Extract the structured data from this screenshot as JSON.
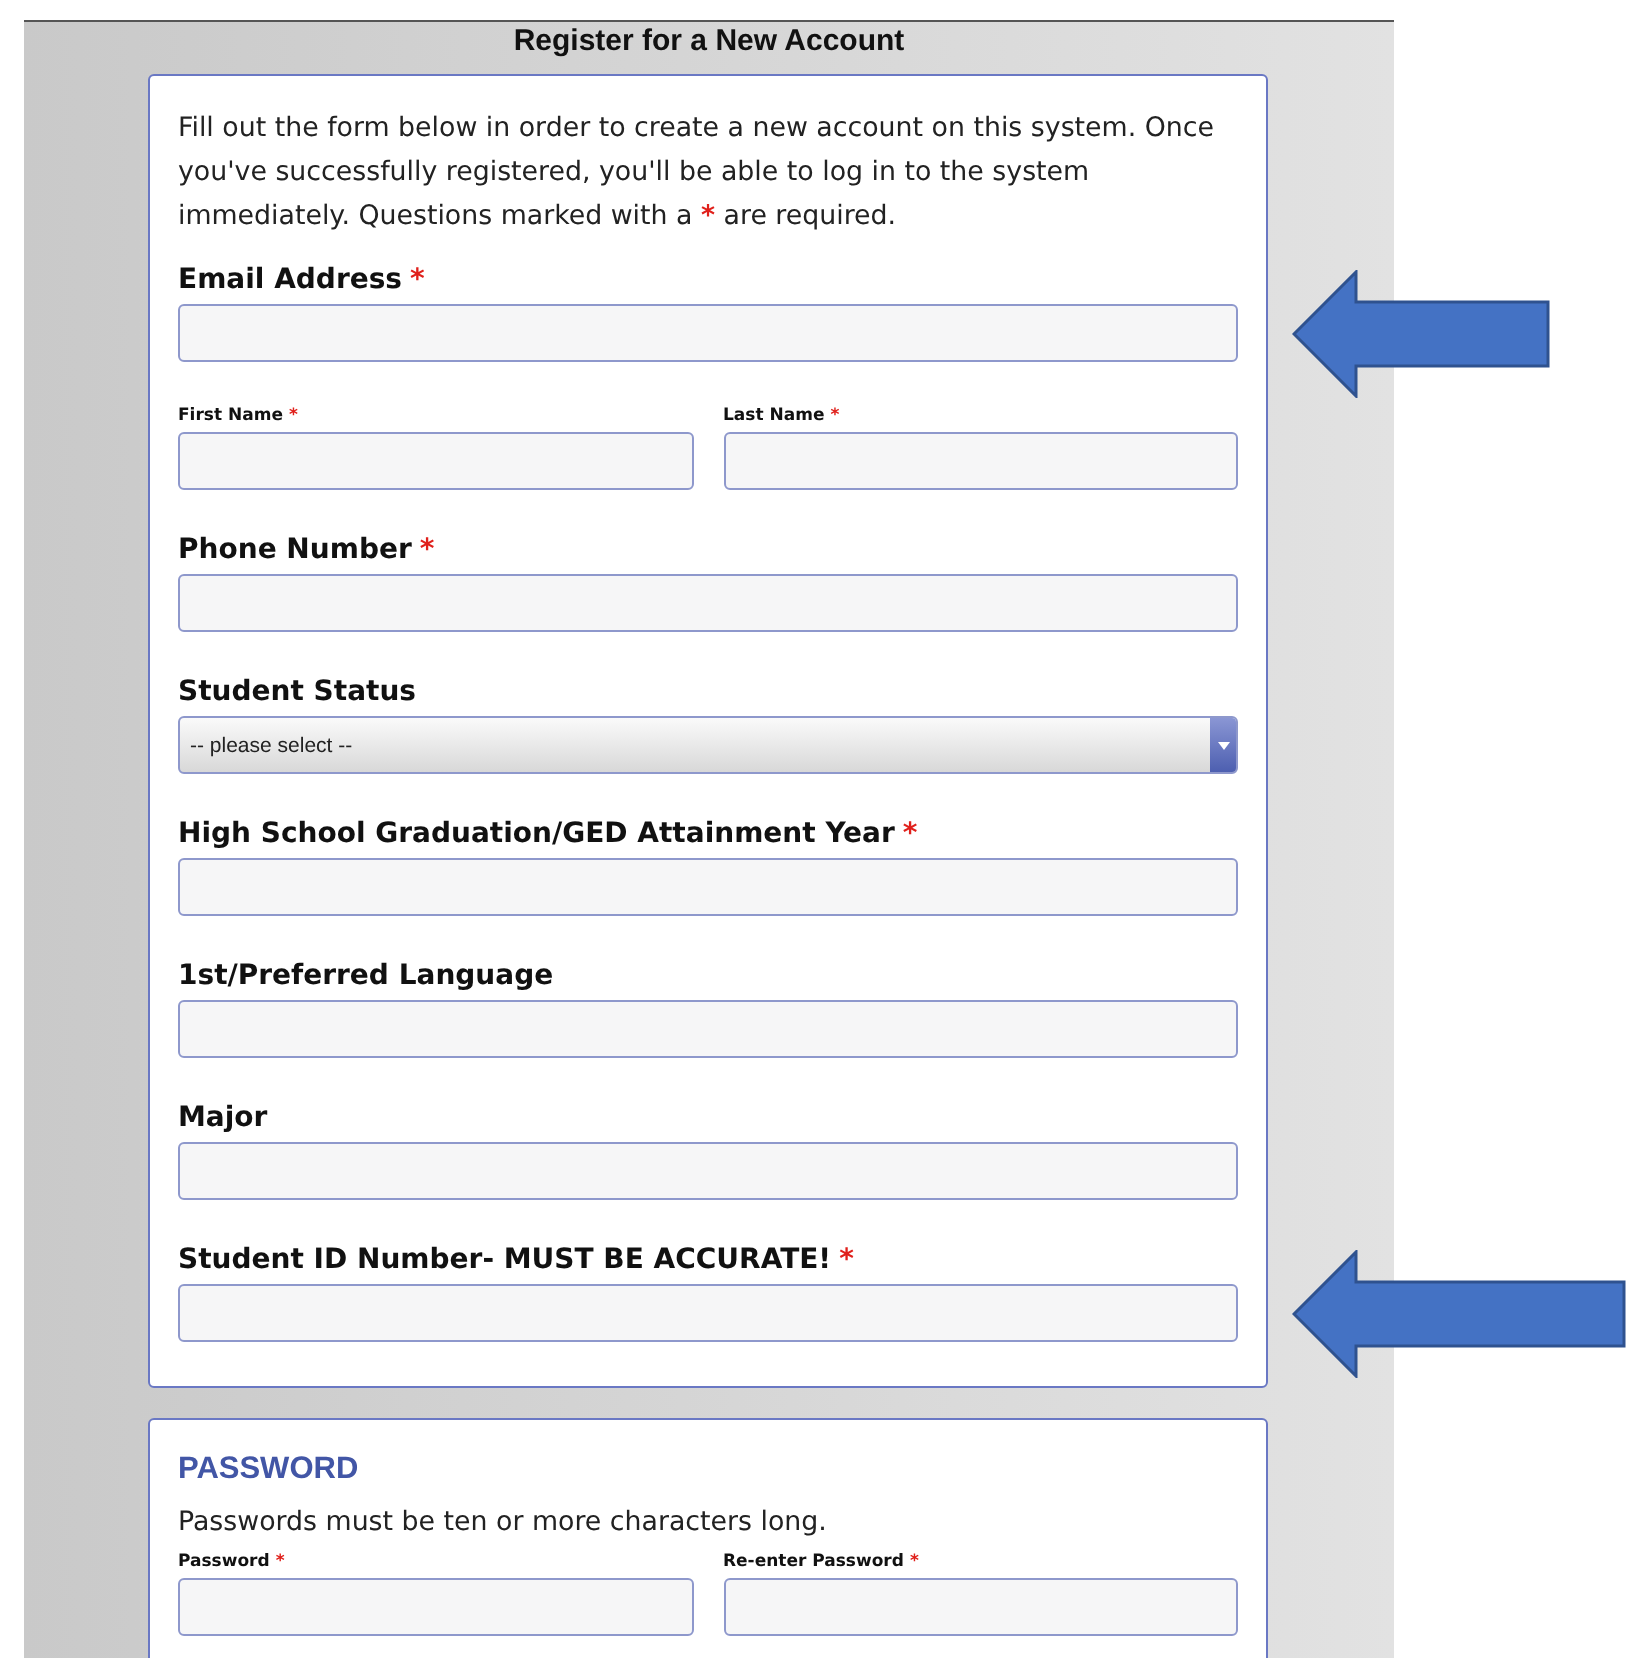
{
  "title": "Register for a New Account",
  "required_mark": "*",
  "intro": {
    "before": "Fill out the form below in order to create a new account on this system. Once you've successfully registered, you'll be able to log in to the system immediately. Questions marked with a ",
    "after": " are required."
  },
  "fields": [
    {
      "kind": "text",
      "label": "Email Address",
      "required": true
    },
    {
      "kind": "pair",
      "items": [
        {
          "label": "First Name",
          "required": true
        },
        {
          "label": "Last Name",
          "required": true
        }
      ]
    },
    {
      "kind": "text",
      "label": "Phone Number",
      "required": true
    },
    {
      "kind": "select",
      "label": "Student Status",
      "required": false,
      "value": "-- please select --"
    },
    {
      "kind": "text",
      "label": "High School Graduation/GED Attainment Year",
      "required": true
    },
    {
      "kind": "text",
      "label": "1st/Preferred Language",
      "required": false
    },
    {
      "kind": "text",
      "label": "Major",
      "required": false
    },
    {
      "kind": "text",
      "label": "Student ID Number- MUST BE ACCURATE!",
      "required": true
    }
  ],
  "password_section": {
    "heading": "PASSWORD",
    "note": "Passwords must be ten or more characters long.",
    "fields": [
      {
        "kind": "pair",
        "items": [
          {
            "label": "Password",
            "required": true
          },
          {
            "label": "Re-enter Password",
            "required": true
          }
        ]
      }
    ]
  }
}
